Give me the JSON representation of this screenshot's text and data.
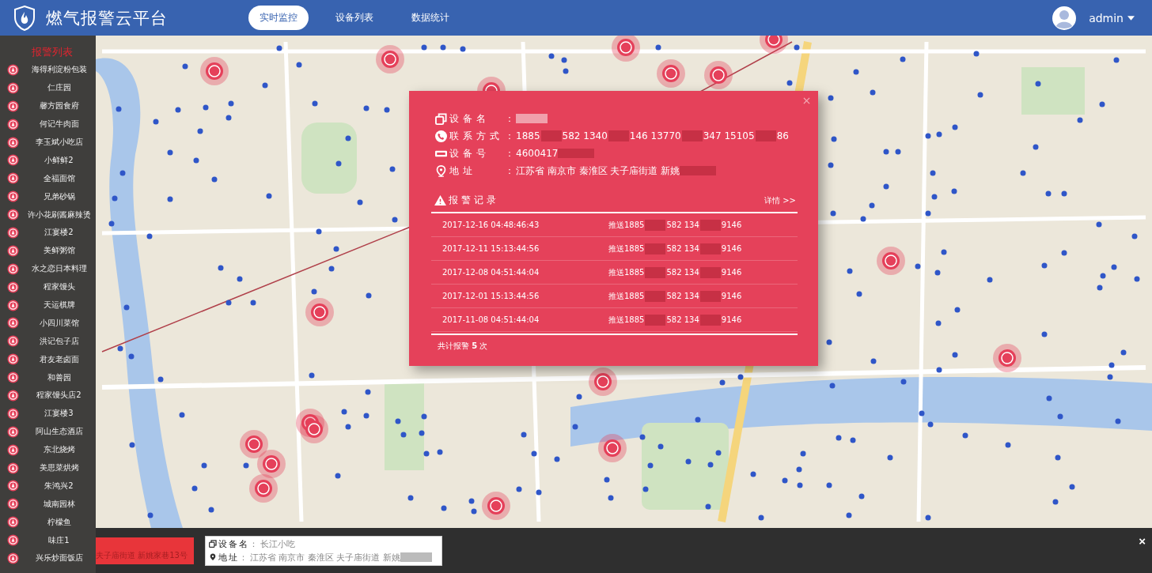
{
  "header": {
    "title": "燃气报警云平台",
    "nav": [
      {
        "label": "实时监控",
        "selected": true
      },
      {
        "label": "设备列表",
        "selected": false
      },
      {
        "label": "数据统计",
        "selected": false
      }
    ],
    "user": "admin"
  },
  "sidebar": {
    "title": "报警列表",
    "items": [
      "海得利淀粉包装",
      "仁庄园",
      "馨方园食府",
      "何记牛肉面",
      "李玉斌小吃店",
      "小鲜鲜2",
      "全福面馆",
      "兄弟砂锅",
      "许小花刷酱麻辣烫",
      "江宴楼2",
      "美鲜粥馆",
      "水之恋日本料理",
      "程家馒头",
      "天运棋牌",
      "小四川菜馆",
      "洪记包子店",
      "君友老卤面",
      "和善园",
      "程家馒头店2",
      "江宴楼3",
      "阿山生态酒店",
      "东北烧烤",
      "美思菜烘烤",
      "朱鸿兴2",
      "城南园林",
      "柠檬鱼",
      "味庄1",
      "兴乐炒面饭店"
    ]
  },
  "popup": {
    "info": [
      {
        "label": "设备名",
        "separator": "：",
        "redacted": true
      },
      {
        "label": "联系方式",
        "separator": "：",
        "segments": [
          "1885",
          "582 1340",
          "146 13770",
          "347 15105",
          "86"
        ],
        "redacted": false
      },
      {
        "label": "设备号",
        "separator": "：",
        "segments": [
          "4600417"
        ],
        "redacted": true
      },
      {
        "label": "地址",
        "separator": "：",
        "segments": [
          "江苏省 南京市 秦淮区 夫子庙街道 新姚"
        ],
        "redacted": true
      }
    ],
    "records_title": "报警记录",
    "details_link": "详情 >>",
    "records": [
      {
        "time": "2017-12-16 04:48:46:43",
        "push": [
          "推送1885",
          "582 134",
          "9146"
        ]
      },
      {
        "time": "2017-12-11 15:13:44:56",
        "push": [
          "推送1885",
          "582 134",
          "9146"
        ]
      },
      {
        "time": "2017-12-08 04:51:44:04",
        "push": [
          "推送1885",
          "582 134",
          "9146"
        ]
      },
      {
        "time": "2017-12-01 15:13:44:56",
        "push": [
          "推送1885",
          "582 134",
          "9146"
        ]
      },
      {
        "time": "2017-11-08 04:51:44:04",
        "push": [
          "推送1885",
          "582 134",
          "9146"
        ]
      }
    ],
    "total": "共计报警 **5** 次"
  },
  "bottom_bar": {
    "alert_text": "夫子庙街道 新姚家巷13号",
    "card": [
      {
        "label": "设备名",
        "separator": "：",
        "value": "长江小吃",
        "redacted": false
      },
      {
        "label": "地址",
        "separator": "：",
        "value": "江苏省 南京市 秦淮区 夫子庙街道 新姚",
        "redacted": true
      }
    ],
    "close": "×"
  }
}
